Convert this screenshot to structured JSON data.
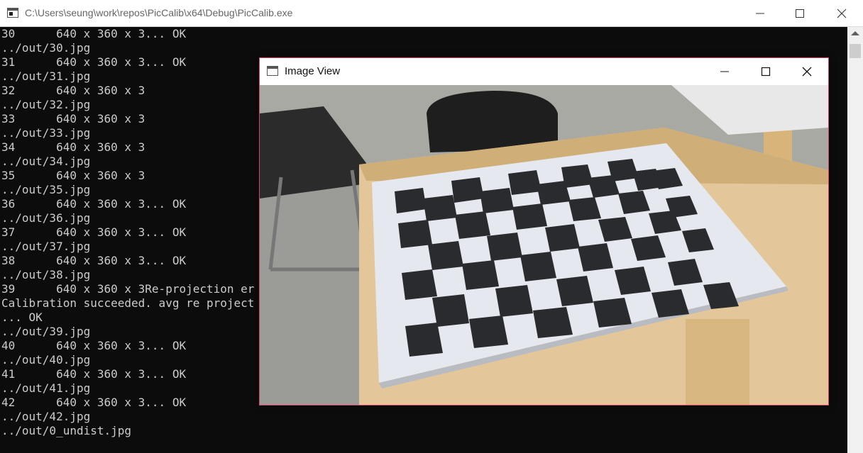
{
  "console": {
    "title": "C:\\Users\\seung\\work\\repos\\PicCalib\\x64\\Debug\\PicCalib.exe",
    "lines": [
      "30      640 x 360 x 3... OK",
      "../out/30.jpg",
      "31      640 x 360 x 3... OK",
      "../out/31.jpg",
      "32      640 x 360 x 3",
      "../out/32.jpg",
      "33      640 x 360 x 3",
      "../out/33.jpg",
      "34      640 x 360 x 3",
      "../out/34.jpg",
      "35      640 x 360 x 3",
      "../out/35.jpg",
      "36      640 x 360 x 3... OK",
      "../out/36.jpg",
      "37      640 x 360 x 3... OK",
      "../out/37.jpg",
      "38      640 x 360 x 3... OK",
      "../out/38.jpg",
      "39      640 x 360 x 3Re-projection er",
      "Calibration succeeded. avg re project",
      "... OK",
      "../out/39.jpg",
      "40      640 x 360 x 3... OK",
      "../out/40.jpg",
      "41      640 x 360 x 3... OK",
      "../out/41.jpg",
      "42      640 x 360 x 3... OK",
      "../out/42.jpg",
      "../out/0_undist.jpg"
    ]
  },
  "image_view": {
    "title": "Image View"
  },
  "colors": {
    "console_bg": "#0c0c0c",
    "console_text": "#cccccc",
    "window_border_accent": "#d4456b"
  },
  "icons": [
    "console-app-icon",
    "minimize-icon",
    "maximize-icon",
    "close-icon",
    "image-view-app-icon"
  ]
}
